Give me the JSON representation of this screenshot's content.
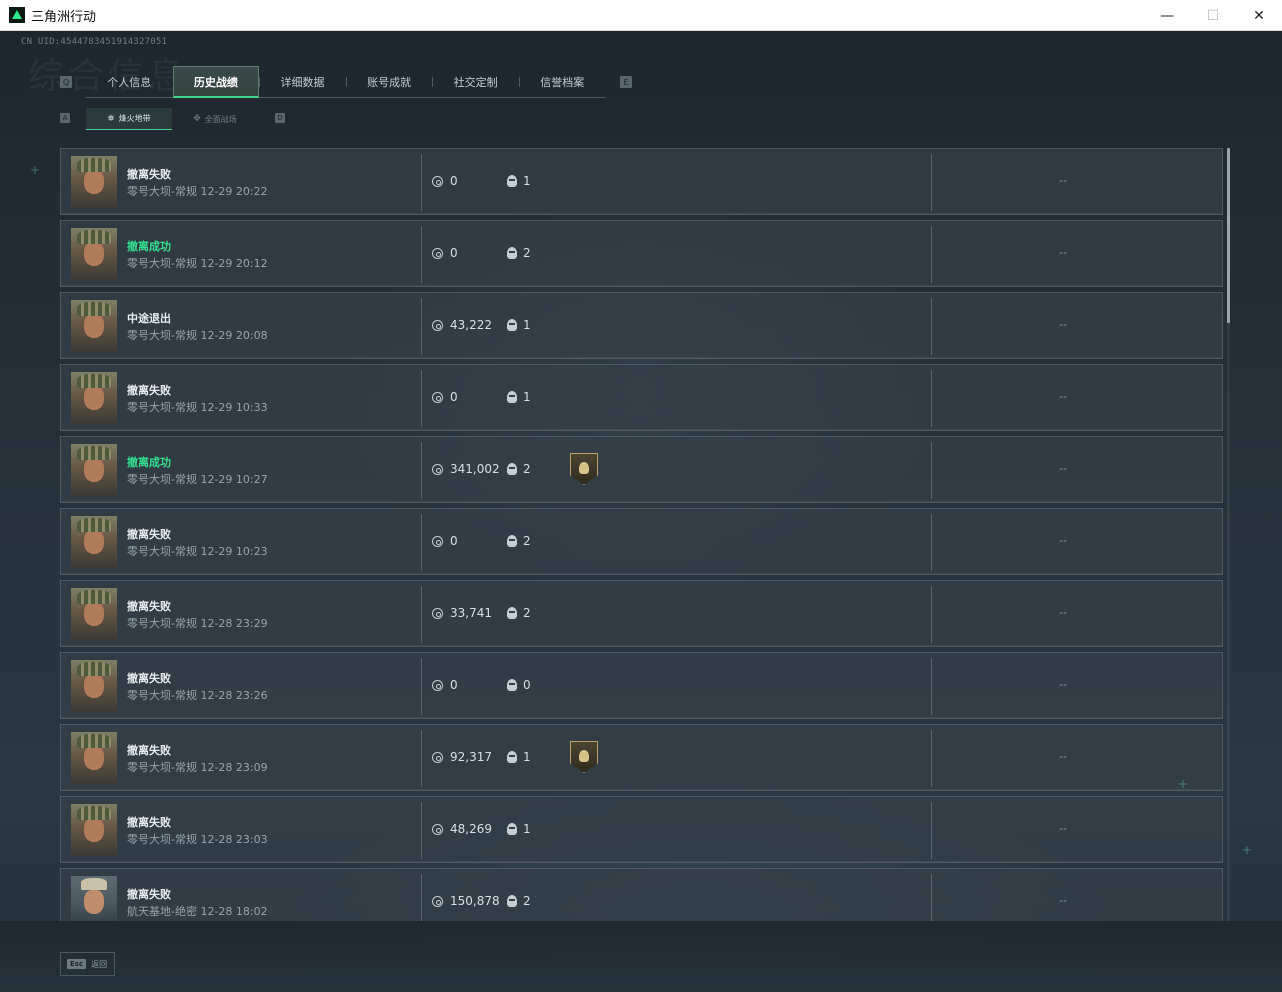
{
  "window": {
    "title": "三角洲行动",
    "minimize": "—",
    "maximize": "☐",
    "close": "✕"
  },
  "header": {
    "uid": "CN UID:4544783451914327051",
    "bg_title": "综合信息",
    "key_left": "Q",
    "key_right": "E"
  },
  "tabs": [
    {
      "label": "个人信息"
    },
    {
      "label": "历史战绩"
    },
    {
      "label": "详细数据"
    },
    {
      "label": "账号成就"
    },
    {
      "label": "社交定制"
    },
    {
      "label": "信誉档案"
    }
  ],
  "subtabs": {
    "key_left": "A",
    "key_right": "D",
    "items": [
      {
        "label": "烽火地带",
        "glyph": "⛯"
      },
      {
        "label": "全面战场",
        "glyph": "✥"
      }
    ]
  },
  "records": [
    {
      "result": "撤离失败",
      "status": "fail",
      "map_time": "零号大坝-常规 12-29 20:22",
      "value": "0",
      "kills": "1",
      "medal": false,
      "extra": "--"
    },
    {
      "result": "撤离成功",
      "status": "success",
      "map_time": "零号大坝-常规 12-29 20:12",
      "value": "0",
      "kills": "2",
      "medal": false,
      "extra": "--"
    },
    {
      "result": "中途退出",
      "status": "fail",
      "map_time": "零号大坝-常规 12-29 20:08",
      "value": "43,222",
      "kills": "1",
      "medal": false,
      "extra": "--"
    },
    {
      "result": "撤离失败",
      "status": "fail",
      "map_time": "零号大坝-常规 12-29 10:33",
      "value": "0",
      "kills": "1",
      "medal": false,
      "extra": "--"
    },
    {
      "result": "撤离成功",
      "status": "success",
      "map_time": "零号大坝-常规 12-29 10:27",
      "value": "341,002",
      "kills": "2",
      "medal": true,
      "extra": "--"
    },
    {
      "result": "撤离失败",
      "status": "fail",
      "map_time": "零号大坝-常规 12-29 10:23",
      "value": "0",
      "kills": "2",
      "medal": false,
      "extra": "--"
    },
    {
      "result": "撤离失败",
      "status": "fail",
      "map_time": "零号大坝-常规 12-28 23:29",
      "value": "33,741",
      "kills": "2",
      "medal": false,
      "extra": "--"
    },
    {
      "result": "撤离失败",
      "status": "fail",
      "map_time": "零号大坝-常规 12-28 23:26",
      "value": "0",
      "kills": "0",
      "medal": false,
      "extra": "--"
    },
    {
      "result": "撤离失败",
      "status": "fail",
      "map_time": "零号大坝-常规 12-28 23:09",
      "value": "92,317",
      "kills": "1",
      "medal": true,
      "extra": "--"
    },
    {
      "result": "撤离失败",
      "status": "fail",
      "map_time": "零号大坝-常规 12-28 23:03",
      "value": "48,269",
      "kills": "1",
      "medal": false,
      "extra": "--"
    },
    {
      "result": "撤离失败",
      "status": "fail",
      "map_time": "航天基地-绝密 12-28 18:02",
      "value": "150,878",
      "kills": "2",
      "medal": false,
      "extra": "--",
      "avatar": "alt"
    }
  ],
  "footer": {
    "esc_key": "Esc",
    "back_label": "返回"
  },
  "colors": {
    "accent": "#3fd28a",
    "success": "#33e08f",
    "row_bg": "#343f48"
  }
}
